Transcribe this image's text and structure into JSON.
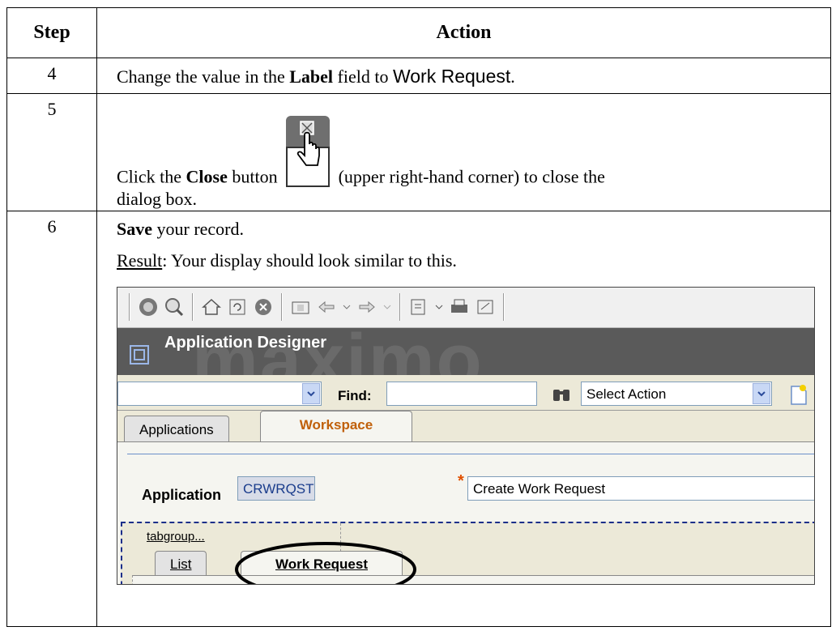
{
  "table": {
    "header_step": "Step",
    "header_action": "Action",
    "rows": [
      {
        "step": "4",
        "text_before": "Change the value in the ",
        "bold": "Label",
        "text_mid": " field to ",
        "sans_value": "Work Request",
        "text_after": "."
      },
      {
        "step": "5",
        "text_before": "Click the ",
        "bold": "Close",
        "text_mid": " button ",
        "text_after": " (upper right-hand corner) to close the",
        "text_line2": "dialog box."
      },
      {
        "step": "6",
        "bold": "Save",
        "text_after": " your record.",
        "result_word": "Result",
        "result_text": ": Your display should look similar to this."
      }
    ]
  },
  "screenshot": {
    "title": "Application Designer",
    "watermark": "maximo",
    "find_label": "Find:",
    "select_action": "Select Action",
    "tabs": [
      "Applications",
      "Workspace"
    ],
    "application_label": "Application",
    "application_value": "CRWRQST",
    "description_value": "Create Work Request",
    "tabgroup_label": "tabgroup...",
    "design_tabs": [
      "List",
      "Work Request"
    ],
    "colors": {
      "banner": "#5a5a5a",
      "active_tab_text": "#c0600a",
      "highlight": "#000000"
    }
  }
}
